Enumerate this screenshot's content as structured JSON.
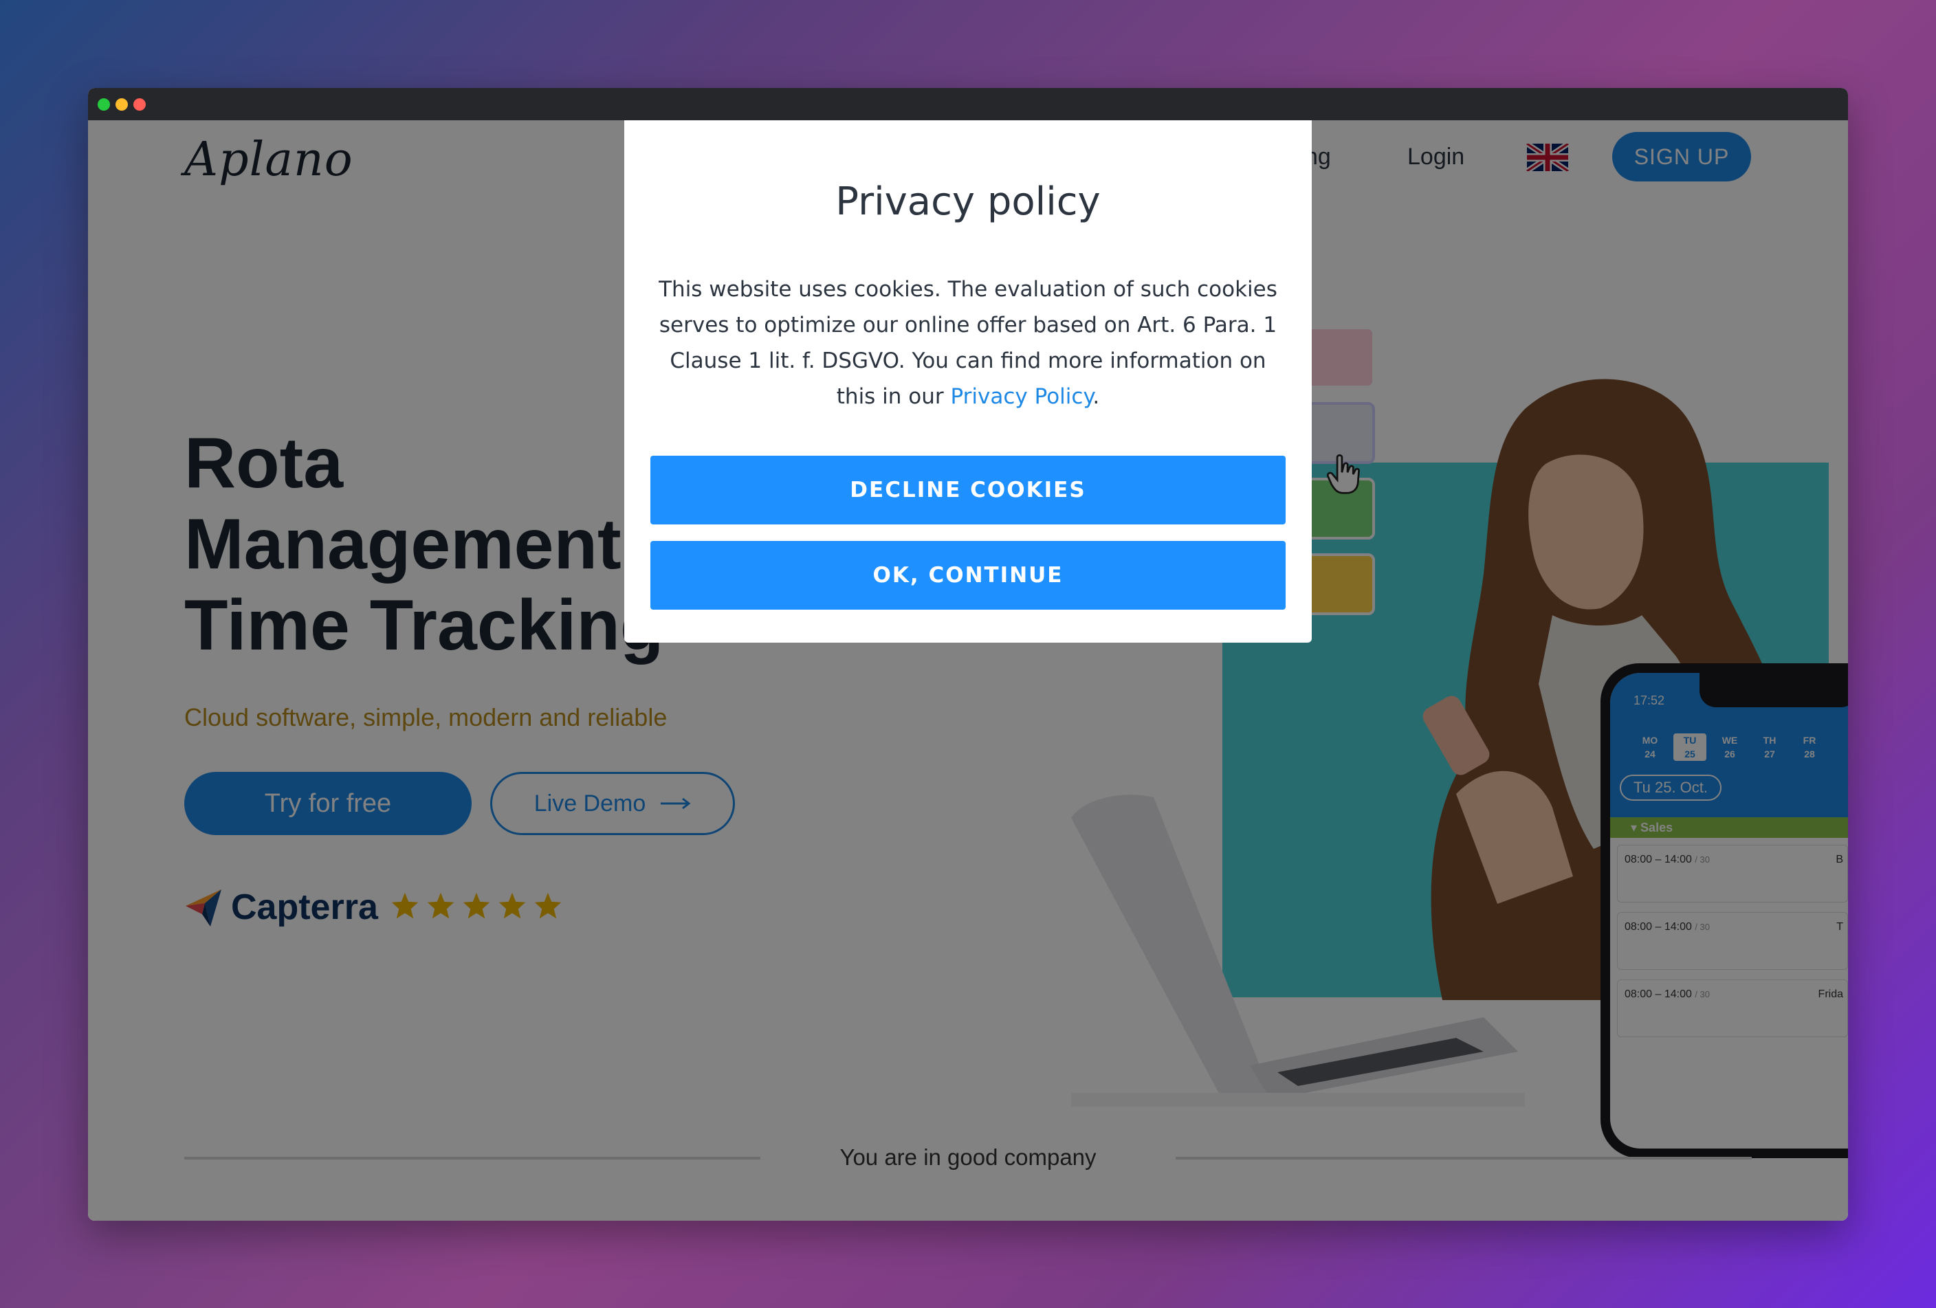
{
  "site": {
    "logo": "Aplano",
    "nav": {
      "pricing": "ng",
      "login": "Login",
      "signup": "SIGN UP"
    },
    "hero": {
      "title_lines": [
        "Rota",
        "Management",
        "Time Tracking"
      ],
      "subtitle": "Cloud software, simple, modern and reliable",
      "try_button": "Try for free",
      "demo_button": "Live Demo",
      "capterra_name": "Capterra",
      "rating_stars": 5
    },
    "good_company": "You are in good company",
    "phone": {
      "time": "17:52",
      "days": [
        {
          "name": "MO",
          "num": "24"
        },
        {
          "name": "TU",
          "num": "25"
        },
        {
          "name": "WE",
          "num": "26"
        },
        {
          "name": "TH",
          "num": "27"
        },
        {
          "name": "FR",
          "num": "28"
        }
      ],
      "date": "Tu 25. Oct.",
      "group": "Sales",
      "shifts": [
        {
          "time": "08:00 – 14:00",
          "break": "/ 30",
          "day": "B"
        },
        {
          "time": "08:00 – 14:00",
          "break": "/ 30",
          "day": "T"
        },
        {
          "time": "08:00 – 14:00",
          "break": "/ 30",
          "day": "Frida"
        }
      ]
    }
  },
  "modal": {
    "title": "Privacy policy",
    "text": "This website uses cookies. The evaluation of such cookies serves to optimize our online offer based on Art. 6 Para. 1 Clause 1 lit. f. DSGVO. You can find more information on this in our",
    "link_text": "Privacy Policy",
    "text_end": ".",
    "decline_label": "DECLINE COOKIES",
    "ok_label": "OK, CONTINUE"
  },
  "colors": {
    "primary": "#1e88e5",
    "modal_button": "#1e90ff",
    "subtitle": "#b78c1e",
    "star": "#f2b705"
  }
}
